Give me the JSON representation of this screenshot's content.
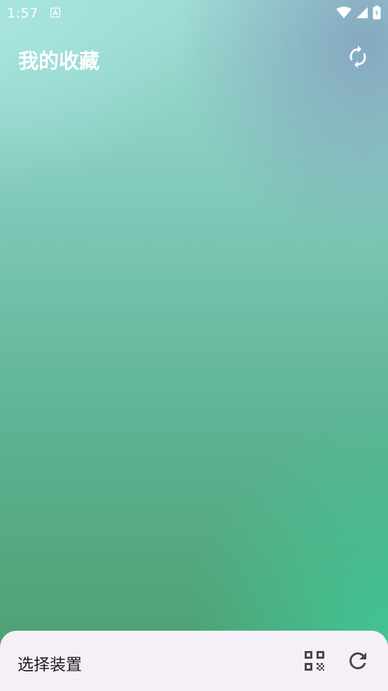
{
  "status_bar": {
    "time": "1:57",
    "icons": [
      "app-notification-icon",
      "wifi-icon",
      "signal-icon",
      "battery-charging-icon"
    ]
  },
  "app_bar": {
    "title": "我的收藏",
    "action_icon": "sync-icon"
  },
  "bottom_sheet": {
    "label": "选择装置",
    "actions": [
      "qr-code-icon",
      "refresh-icon"
    ]
  },
  "colors": {
    "sheet_background": "#f5f0f8",
    "label_text": "#1f1b22",
    "icon_dark": "#4a4650",
    "title_text": "#ffffff"
  }
}
